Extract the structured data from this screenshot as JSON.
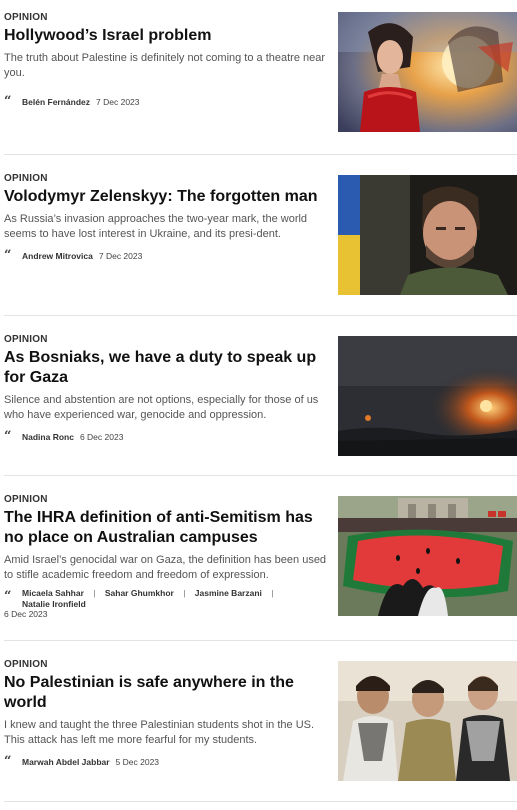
{
  "articles": [
    {
      "kicker": "OPINION",
      "headline": "Hollywood’s Israel problem",
      "summary": "The truth about Palestine is definitely not coming to a theatre near you.",
      "author": "Belén Fernández",
      "date": "7 Dec 2023",
      "image": "hollywood-premiere-photo"
    },
    {
      "kicker": "OPINION",
      "headline": "Volodymyr Zelenskyy: The forgotten man",
      "summary": "As Russia’s invasion approaches the two-year mark, the world seems to have lost interest in Ukraine, and its presi-dent.",
      "author": "Andrew Mitrovica",
      "date": "7 Dec 2023",
      "image": "zelenskyy-portrait-photo"
    },
    {
      "kicker": "OPINION",
      "headline": "As Bosniaks, we have a duty to speak up for Gaza",
      "summary": "Silence and abstention are not options, especially for those of us who have experienced war, genocide and oppression.",
      "author": "Nadina Ronc",
      "date": "6 Dec 2023",
      "image": "gaza-night-explosion-photo"
    },
    {
      "kicker": "OPINION",
      "headline": "The IHRA definition of anti-Semitism has no place on Australian campuses",
      "summary": "Amid Israel’s genocidal war on Gaza, the definition has been used to stifle academic freedom and freedom of expression.",
      "authors": [
        "Micaela Sahhar",
        "Sahar Ghumkhor",
        "Jasmine Barzani",
        "Natalie Ironfield"
      ],
      "separator": "|",
      "date": "6 Dec 2023",
      "image": "campus-watermelon-banner-photo"
    },
    {
      "kicker": "OPINION",
      "headline": "No Palestinian is safe anywhere in the world",
      "summary": "I knew and taught the three Palestinian students shot in the US. This attack has left me more fearful for my students.",
      "author": "Marwah Abdel Jabbar",
      "date": "5 Dec 2023",
      "image": "three-students-photo"
    }
  ]
}
